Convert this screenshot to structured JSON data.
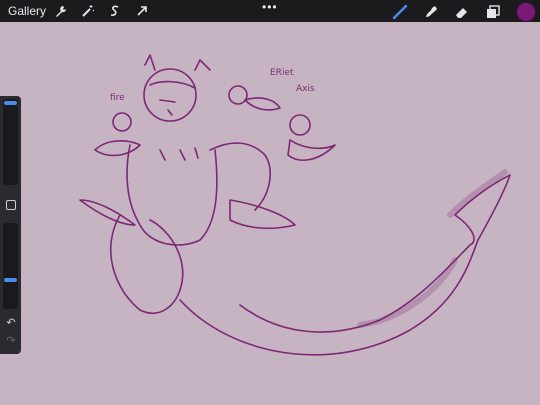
{
  "topbar": {
    "gallery_label": "Gallery",
    "left_tools": [
      "wrench-icon",
      "magic-wand-icon",
      "selection-s-icon",
      "transform-arrow-icon"
    ],
    "more_label": "•••",
    "right_tools": [
      "brush-icon",
      "smudge-icon",
      "eraser-icon",
      "layers-icon"
    ],
    "current_color": "#7a1a78"
  },
  "sidebar": {
    "brush_size_level": 0.02,
    "opacity_level": 0.67
  },
  "canvas": {
    "background": "#c6b4c2",
    "ink_color": "#7d2775",
    "labels": {
      "fire": "fire",
      "eriet": "ERiet",
      "axis": "Axis"
    }
  }
}
